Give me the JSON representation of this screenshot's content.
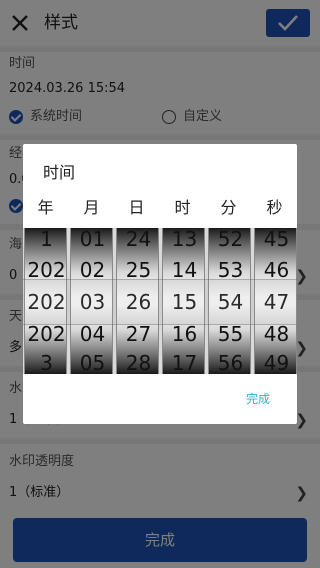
{
  "header": {
    "title": "样式"
  },
  "time_section": {
    "label": "时间",
    "value": "2024.03.26 15:54",
    "option_system": "系统时间",
    "option_custom": "自定义"
  },
  "coord_section": {
    "label_partial": "经",
    "value_partial": "0.0"
  },
  "altitude_section": {
    "label_partial": "海",
    "value_partial": "0"
  },
  "weather_section": {
    "label_partial": "天",
    "value_partial": "多"
  },
  "watermark_section": {
    "label_partial": "水",
    "value_partial": "1（标准）"
  },
  "opacity_section": {
    "label": "水印透明度",
    "value": "1（标准）"
  },
  "bottom_button": {
    "label": "完成"
  },
  "dialog": {
    "title": "时间",
    "columns": [
      "年",
      "月",
      "日",
      "时",
      "分",
      "秒"
    ],
    "wheels": [
      {
        "above": "1",
        "selected": "202",
        "below": "202",
        "below2": "3"
      },
      {
        "above": "01",
        "selected": "02",
        "below": "03",
        "below2": "04",
        "below3": "05"
      },
      {
        "above": "24",
        "selected": "25",
        "below": "26",
        "below2": "27",
        "below3": "28"
      },
      {
        "above": "13",
        "selected": "14",
        "below": "15",
        "below2": "16",
        "below3": "17"
      },
      {
        "above": "52",
        "selected": "53",
        "below": "54",
        "below2": "55",
        "below3": "56"
      },
      {
        "above": "45",
        "selected": "46",
        "below": "47",
        "below2": "48",
        "below3": "49"
      }
    ],
    "done_label": "完成"
  },
  "colors": {
    "primary": "#1f53b8",
    "accent_done": "#29b6c8"
  }
}
